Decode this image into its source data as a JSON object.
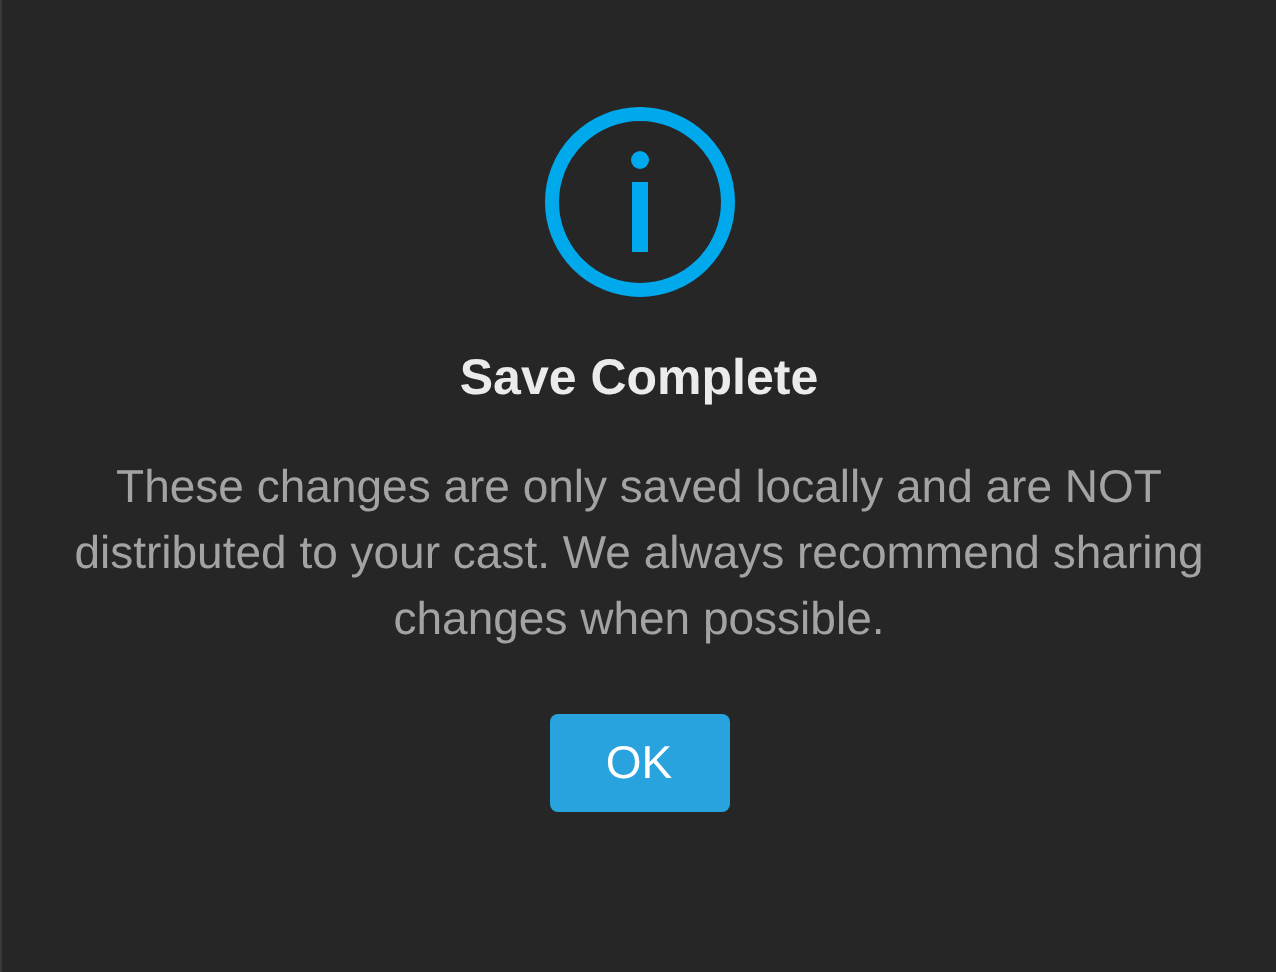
{
  "dialog": {
    "title": "Save Complete",
    "message": "These changes are only saved locally and are NOT distributed to your cast. We always recommend sharing changes when possible.",
    "buttons": [
      "OK"
    ]
  }
}
